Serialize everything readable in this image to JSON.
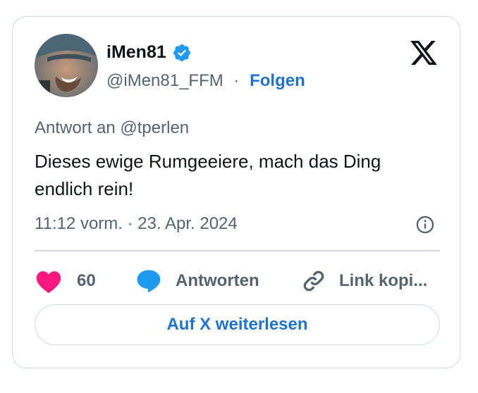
{
  "author": {
    "display_name": "iMen81",
    "handle": "@iMen81_FFM",
    "separator": "·",
    "follow_label": "Folgen",
    "verified_icon": "verified-badge-icon"
  },
  "brand": {
    "logo_icon": "x-logo-icon"
  },
  "tweet": {
    "reply_to": "Antwort an @tperlen",
    "text": "Dieses ewige Rumgeeiere, mach das Ding endlich rein!",
    "timestamp": "11:12 vorm. · 23. Apr. 2024"
  },
  "actions": {
    "like_count": "60",
    "reply_label": "Antworten",
    "copy_link_label": "Link kopi..."
  },
  "read_more_label": "Auf X weiterlesen",
  "colors": {
    "like": "#f91880",
    "reply": "#1d9bf0",
    "link": "#1d73d0",
    "muted": "#536471",
    "text": "#0f1419",
    "border": "#cfd9de"
  }
}
